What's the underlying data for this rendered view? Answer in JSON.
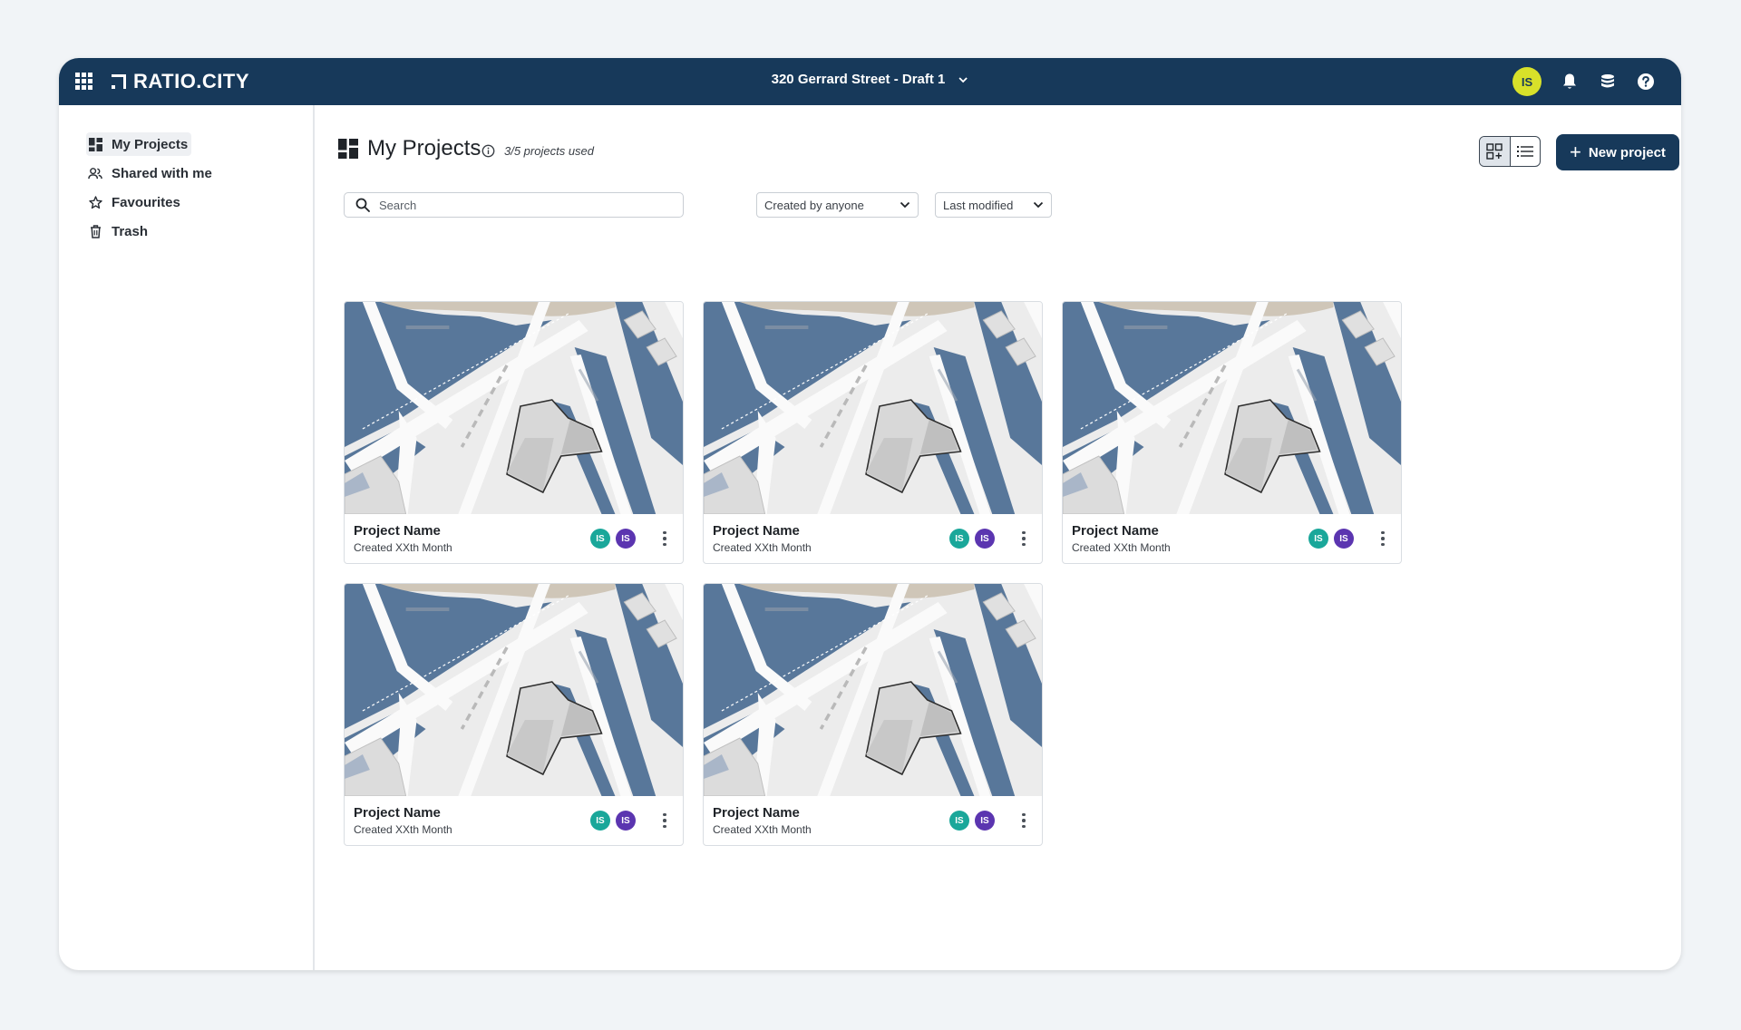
{
  "app": {
    "logo_text": "RATIO.CITY",
    "document_title": "320 Gerrard Street - Draft 1",
    "user_initials": "IS",
    "colors": {
      "navbar": "#17395a",
      "user_avatar": "#d8e12a",
      "collab_teal": "#1aa79a",
      "collab_purple": "#5b35b0"
    }
  },
  "sidebar": {
    "items": [
      {
        "label": "My Projects",
        "icon": "dashboard-icon",
        "active": true
      },
      {
        "label": "Shared with me",
        "icon": "users-icon",
        "active": false
      },
      {
        "label": "Favourites",
        "icon": "star-icon",
        "active": false
      },
      {
        "label": "Trash",
        "icon": "trash-icon",
        "active": false
      }
    ]
  },
  "main": {
    "title": "My Projects",
    "usage": "3/5 projects used",
    "new_project_label": "New project",
    "search_placeholder": "Search",
    "filter_owner": "Created by anyone",
    "sort_by": "Last modified",
    "view_mode": "grid"
  },
  "projects": [
    {
      "name": "Project Name",
      "date": "Created XXth Month",
      "collaborators": [
        "IS",
        "IS"
      ]
    },
    {
      "name": "Project Name",
      "date": "Created XXth Month",
      "collaborators": [
        "IS",
        "IS"
      ]
    },
    {
      "name": "Project Name",
      "date": "Created XXth Month",
      "collaborators": [
        "IS",
        "IS"
      ]
    },
    {
      "name": "Project Name",
      "date": "Created XXth Month",
      "collaborators": [
        "IS",
        "IS"
      ]
    },
    {
      "name": "Project Name",
      "date": "Created XXth Month",
      "collaborators": [
        "IS",
        "IS"
      ]
    }
  ]
}
